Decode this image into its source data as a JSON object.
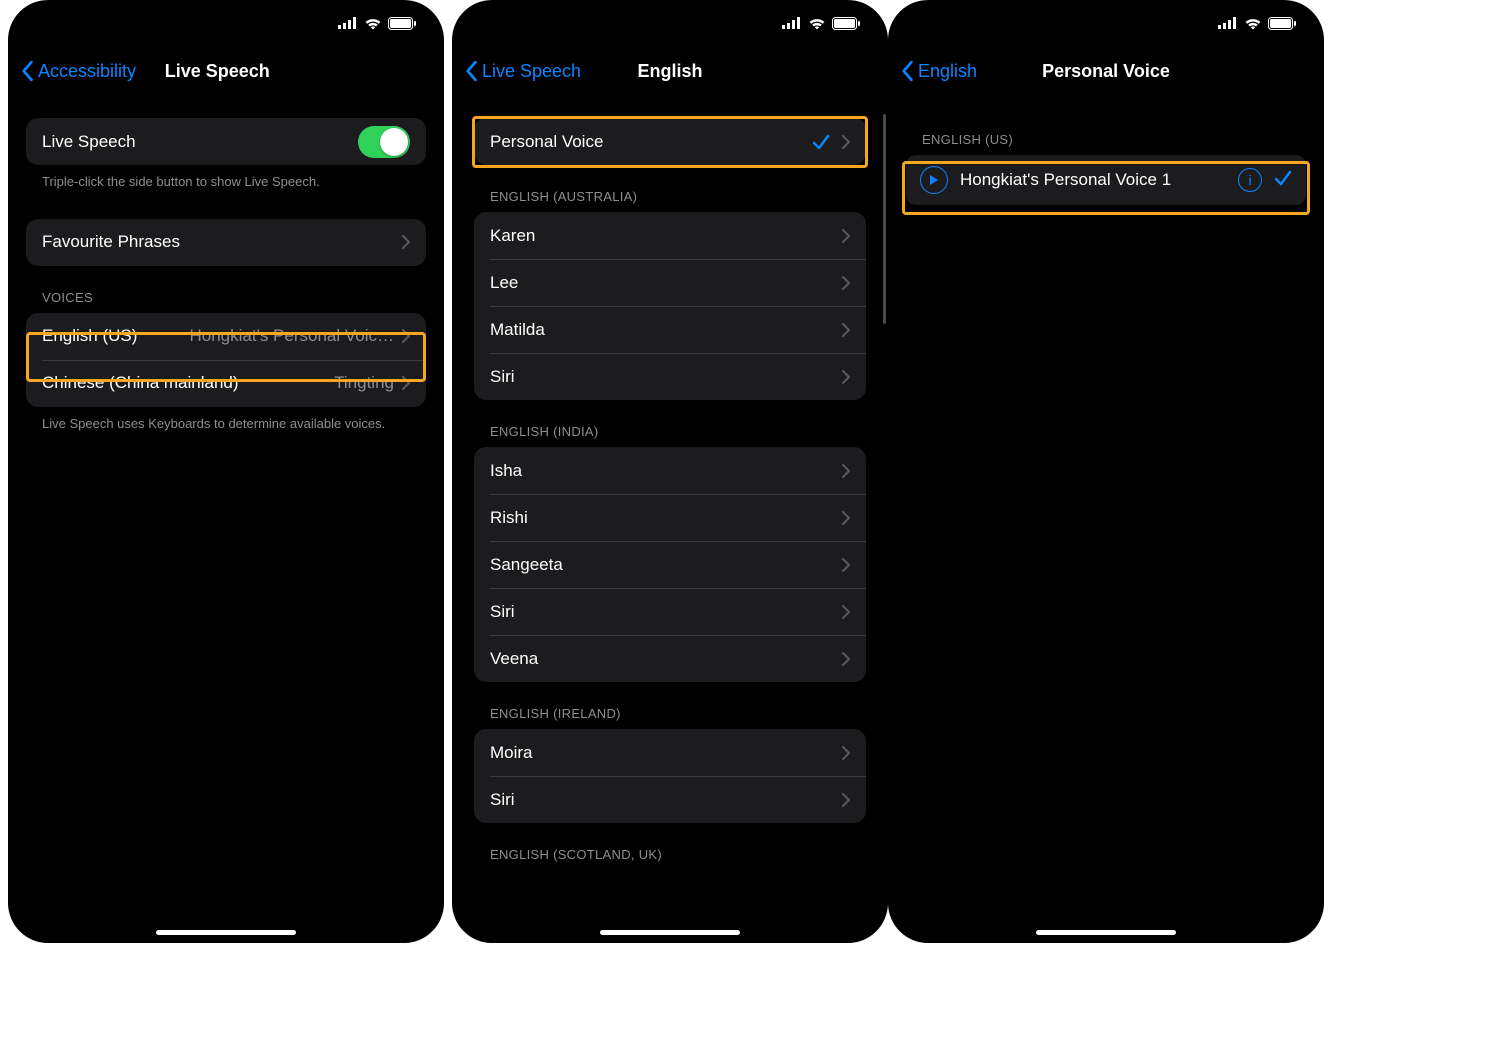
{
  "panel1": {
    "back_label": "Accessibility",
    "title": "Live Speech",
    "toggle_label": "Live Speech",
    "toggle_note": "Triple-click the side button to show Live Speech.",
    "fav_label": "Favourite Phrases",
    "voices_header": "VOICES",
    "voices": [
      {
        "lang": "English (US)",
        "voice": "Hongkiat's Personal Voic…"
      },
      {
        "lang": "Chinese (China mainland)",
        "voice": "Tingting"
      }
    ],
    "voices_note": "Live Speech uses Keyboards to determine available voices."
  },
  "panel2": {
    "back_label": "Live Speech",
    "title": "English",
    "personal_voice": "Personal Voice",
    "groups": [
      {
        "header": "ENGLISH (AUSTRALIA)",
        "items": [
          "Karen",
          "Lee",
          "Matilda",
          "Siri"
        ]
      },
      {
        "header": "ENGLISH (INDIA)",
        "items": [
          "Isha",
          "Rishi",
          "Sangeeta",
          "Siri",
          "Veena"
        ]
      },
      {
        "header": "ENGLISH (IRELAND)",
        "items": [
          "Moira",
          "Siri"
        ]
      },
      {
        "header": "ENGLISH (SCOTLAND, UK)",
        "items": []
      }
    ]
  },
  "panel3": {
    "back_label": "English",
    "title": "Personal Voice",
    "header": "ENGLISH (US)",
    "voice_name": "Hongkiat's Personal Voice 1"
  }
}
